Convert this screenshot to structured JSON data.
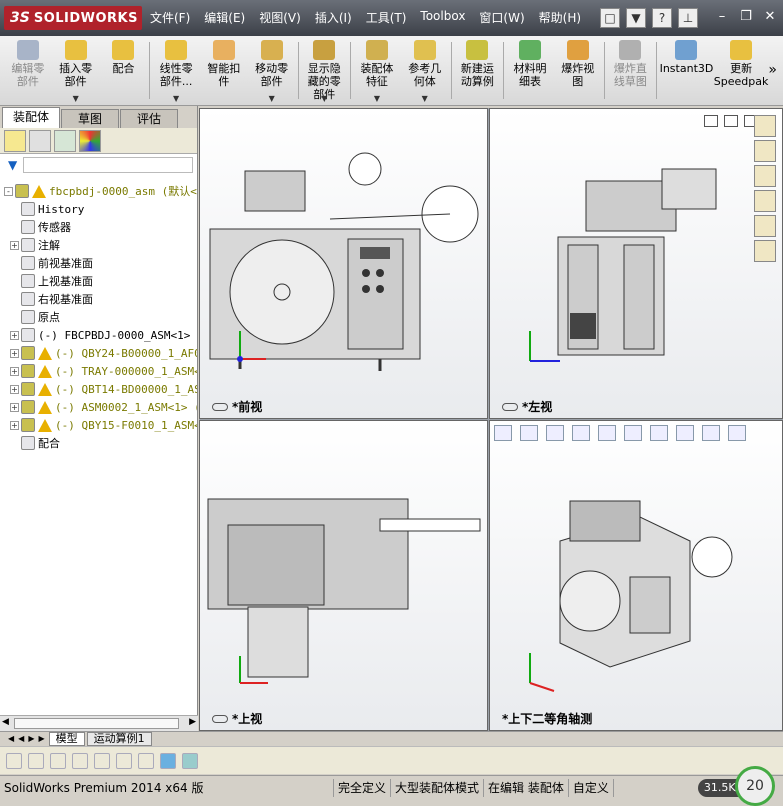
{
  "app": {
    "logo_ds": "3S",
    "logo_name": "SOLIDWORKS"
  },
  "menu": [
    "文件(F)",
    "编辑(E)",
    "视图(V)",
    "插入(I)",
    "工具(T)",
    "Toolbox",
    "窗口(W)",
    "帮助(H)"
  ],
  "toolbar": [
    {
      "label": "编辑零\n部件",
      "disabled": true
    },
    {
      "label": "插入零\n部件"
    },
    {
      "label": "配合"
    },
    {
      "label": "线性零\n部件..."
    },
    {
      "label": "智能扣\n件"
    },
    {
      "label": "移动零\n部件"
    },
    {
      "label": "显示隐\n藏的零\n部件"
    },
    {
      "label": "装配体\n特征"
    },
    {
      "label": "参考几\n何体"
    },
    {
      "label": "新建运\n动算例"
    },
    {
      "label": "材料明\n细表"
    },
    {
      "label": "爆炸视\n图"
    },
    {
      "label": "爆炸直\n线草图",
      "disabled": true
    },
    {
      "label": "Instant3D"
    },
    {
      "label": "更新\nSpeedpak"
    }
  ],
  "left_tabs": [
    "装配体",
    "草图",
    "评估"
  ],
  "tree": [
    {
      "text": "fbcpbdj-0000_asm  (默认<默认",
      "indent": 0,
      "warn": true,
      "olive": true,
      "expand": "-"
    },
    {
      "text": "History",
      "indent": 1
    },
    {
      "text": "传感器",
      "indent": 1
    },
    {
      "text": "注解",
      "indent": 1,
      "expand": "+"
    },
    {
      "text": "前视基准面",
      "indent": 1
    },
    {
      "text": "上视基准面",
      "indent": 1
    },
    {
      "text": "右视基准面",
      "indent": 1
    },
    {
      "text": "原点",
      "indent": 1
    },
    {
      "text": "(-) FBCPBDJ-0000_ASM<1> (",
      "indent": 1,
      "expand": "+"
    },
    {
      "text": "(-) QBY24-B00000_1_AF0_",
      "indent": 1,
      "expand": "+",
      "warn": true,
      "olive": true
    },
    {
      "text": "(-) TRAY-000000_1_ASM<1",
      "indent": 1,
      "expand": "+",
      "warn": true,
      "olive": true
    },
    {
      "text": "(-) QBT14-BD00000_1_ASM",
      "indent": 1,
      "expand": "+",
      "warn": true,
      "olive": true
    },
    {
      "text": "(-) ASM0002_1_ASM<1> (",
      "indent": 1,
      "expand": "+",
      "warn": true,
      "olive": true
    },
    {
      "text": "(-) QBY15-F0010_1_ASM<1",
      "indent": 1,
      "expand": "+",
      "warn": true,
      "olive": true
    },
    {
      "text": "配合",
      "indent": 1
    }
  ],
  "views": {
    "front": "*前视",
    "left": "*左视",
    "top": "*上视",
    "iso": "*上下二等角轴测"
  },
  "bottom_tabs": [
    "模型",
    "运动算例1"
  ],
  "status": {
    "product": "SolidWorks Premium 2014 x64 版",
    "s1": "完全定义",
    "s2": "大型装配体模式",
    "s3": "在编辑 装配体",
    "s4": "自定义",
    "speed": "31.5K/s",
    "gauge": "20"
  },
  "colors": {
    "accent": "#b0222b",
    "warning": "#e8b000"
  }
}
